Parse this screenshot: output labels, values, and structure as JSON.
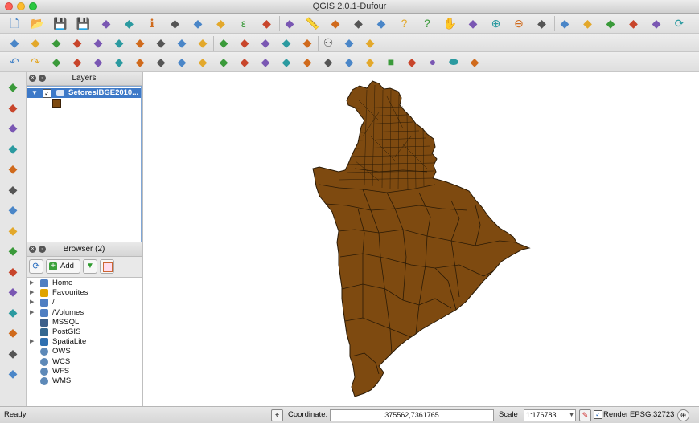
{
  "window": {
    "title": "QGIS 2.0.1-Dufour"
  },
  "colors": {
    "polygon_fill": "#7e4a10",
    "polygon_stroke": "#2a1a06",
    "layer_selected": "#3d79c8"
  },
  "toolbars": {
    "row1": [
      "new-project-icon",
      "open-project-icon",
      "save-project-icon",
      "save-as-icon",
      "new-print-composer-icon",
      "print-composer-manager-icon",
      "identify-icon",
      "pan-icon",
      "select-icon",
      "deselect-icon",
      "expression-select-icon",
      "attribute-table-icon",
      "statistics-icon",
      "measure-icon",
      "annotation-icon",
      "label-tool-icon",
      "text-annotation-icon",
      "help-icon",
      "whats-this-icon",
      "hand-pan-icon",
      "pan-to-selection-icon",
      "zoom-in-icon",
      "zoom-out-icon",
      "zoom-native-icon",
      "zoom-full-icon",
      "zoom-selection-icon",
      "zoom-layer-icon",
      "zoom-last-icon",
      "zoom-next-icon",
      "refresh-icon"
    ],
    "row2": [
      "toggle-edit-icon",
      "save-edits-icon",
      "add-feature-icon",
      "move-feature-icon",
      "node-tool-icon",
      "delete-selected-icon",
      "cut-features-icon",
      "copy-features-icon",
      "paste-features-icon",
      "label-abc-icon",
      "label-pin-icon",
      "label-show-icon",
      "label-move-icon",
      "label-rotate-icon",
      "label-change-icon",
      "binoculars-icon",
      "plugin-icon",
      "python-console-icon"
    ],
    "row3": [
      "undo-icon",
      "redo-icon",
      "simplify-icon",
      "add-ring-icon",
      "add-part-icon",
      "fill-ring-icon",
      "delete-ring-icon",
      "delete-part-icon",
      "reshape-icon",
      "offset-curve-icon",
      "split-features-icon",
      "split-parts-icon",
      "merge-features-icon",
      "merge-attributes-icon",
      "rotate-point-icon",
      "rotate-feature-icon",
      "digitize-icon",
      "advanced-digitize-icon",
      "rectangle-icon",
      "polygon-icon",
      "circle-icon",
      "ellipse-icon",
      "gps-icon"
    ]
  },
  "left_toolbar": [
    "add-vector-layer-icon",
    "add-raster-layer-icon",
    "add-postgis-icon",
    "add-spatialite-icon",
    "add-mssql-icon",
    "add-wms-icon",
    "add-wcs-icon",
    "add-wfs-icon",
    "add-delimited-text-icon",
    "new-shapefile-icon",
    "remove-layer-icon",
    "digitize-line-icon",
    "georeferencer-icon",
    "new-spatialite-icon",
    "raster-calc-icon"
  ],
  "layers_panel": {
    "title": "Layers",
    "layers": [
      {
        "name": "SetoresIBGE2010...",
        "checked": true
      }
    ]
  },
  "browser_panel": {
    "title": "Browser (2)",
    "add_label": "Add",
    "items": [
      {
        "label": "Home",
        "icon": "folder-icon",
        "expandable": true
      },
      {
        "label": "Favourites",
        "icon": "star-icon",
        "expandable": true
      },
      {
        "label": "/",
        "icon": "folder-icon",
        "expandable": true
      },
      {
        "label": "/Volumes",
        "icon": "folder-icon",
        "expandable": true
      },
      {
        "label": "MSSQL",
        "icon": "mssql-icon",
        "expandable": false
      },
      {
        "label": "PostGIS",
        "icon": "postgis-icon",
        "expandable": false
      },
      {
        "label": "SpatiaLite",
        "icon": "spatialite-icon",
        "expandable": true
      },
      {
        "label": "OWS",
        "icon": "globe-icon",
        "expandable": false
      },
      {
        "label": "WCS",
        "icon": "globe-icon",
        "expandable": false
      },
      {
        "label": "WFS",
        "icon": "globe-icon",
        "expandable": false
      },
      {
        "label": "WMS",
        "icon": "globe-icon",
        "expandable": false
      }
    ]
  },
  "status": {
    "ready": "Ready",
    "coordinate_label": "Coordinate:",
    "coordinate_value": "375562,7361765",
    "scale_label": "Scale",
    "scale_value": "1:176783",
    "render_label": "Render",
    "render_checked": true,
    "epsg": "EPSG:32723"
  }
}
